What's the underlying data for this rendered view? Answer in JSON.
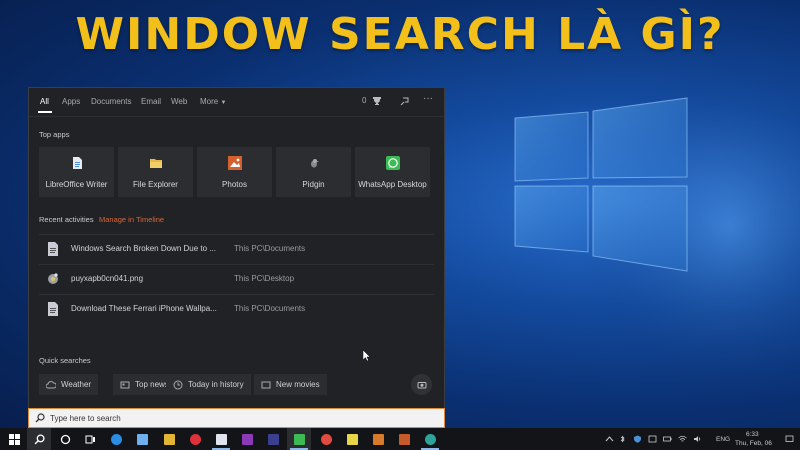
{
  "headline": "WINDOW SEARCH LÀ GÌ?",
  "colors": {
    "headline": "#f3c01b",
    "accent_orange": "#d7693b",
    "panel_bg": "#202225"
  },
  "tabs": {
    "items": [
      {
        "label": "All",
        "active": true
      },
      {
        "label": "Apps"
      },
      {
        "label": "Documents"
      },
      {
        "label": "Email"
      },
      {
        "label": "Web"
      },
      {
        "label": "More"
      }
    ],
    "points": "0",
    "trophy_icon": "trophy-icon",
    "feedback_icon": "feedback-icon",
    "more_options": "···"
  },
  "top_apps": {
    "title": "Top apps",
    "items": [
      {
        "label": "LibreOffice Writer",
        "icon": "libreoffice-writer-icon",
        "color": "#4a90d9"
      },
      {
        "label": "File Explorer",
        "icon": "folder-icon",
        "color": "#e8b84a"
      },
      {
        "label": "Photos",
        "icon": "photos-icon",
        "color": "#d4602e"
      },
      {
        "label": "Pidgin",
        "icon": "pidgin-icon",
        "color": "#6b6b6b"
      },
      {
        "label": "WhatsApp Desktop",
        "icon": "whatsapp-icon",
        "color": "#3cba54"
      }
    ]
  },
  "recent": {
    "title": "Recent activities",
    "manage_link": "Manage in Timeline",
    "items": [
      {
        "name": "Windows Search Broken Down Due to ...",
        "path": "This PC\\Documents",
        "icon": "document-icon"
      },
      {
        "name": "puyxapb0cn041.png",
        "path": "This PC\\Desktop",
        "icon": "image-file-icon"
      },
      {
        "name": "Download These Ferrari iPhone Wallpa...",
        "path": "This PC\\Documents",
        "icon": "document-icon"
      }
    ]
  },
  "quick": {
    "title": "Quick searches",
    "items": [
      {
        "label": "Weather",
        "icon": "cloud-icon"
      },
      {
        "label": "Top news",
        "icon": "news-icon"
      },
      {
        "label": "Today in history",
        "icon": "clock-icon"
      },
      {
        "label": "New movies",
        "icon": "movie-icon"
      }
    ]
  },
  "search": {
    "placeholder": "Type here to search"
  },
  "tray": {
    "lang": "ENG",
    "time": "6:33",
    "date": "Thu, Feb, 06"
  }
}
